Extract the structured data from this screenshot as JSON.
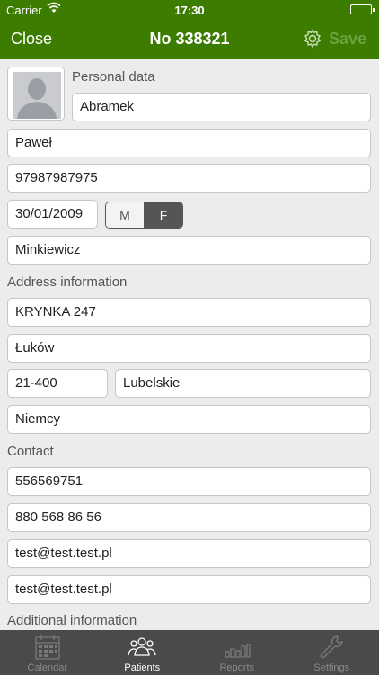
{
  "status_bar": {
    "carrier": "Carrier",
    "time": "17:30"
  },
  "nav": {
    "close": "Close",
    "title": "No 338321",
    "save": "Save"
  },
  "personal": {
    "heading": "Personal data",
    "last_name": "Abramek",
    "first_name": "Paweł",
    "pesel": "97987987975",
    "birth_date": "30/01/2009",
    "gender_options": [
      "M",
      "F"
    ],
    "gender_selected": "F",
    "other_name": "Minkiewicz"
  },
  "address": {
    "heading": "Address information",
    "street": "KRYNKA 247",
    "city": "Łuków",
    "postal_code": "21-400",
    "region": "Lubelskie",
    "country": "Niemcy"
  },
  "contact": {
    "heading": "Contact",
    "phone1": "556569751",
    "phone2": "880 568 86 56",
    "email1": "test@test.test.pl",
    "email2": "test@test.test.pl"
  },
  "additional": {
    "heading": "Additional information"
  },
  "tabs": [
    {
      "label": "Calendar",
      "icon": "calendar-icon",
      "active": false
    },
    {
      "label": "Patients",
      "icon": "patients-icon",
      "active": true
    },
    {
      "label": "Reports",
      "icon": "reports-icon",
      "active": false
    },
    {
      "label": "Settings",
      "icon": "settings-icon",
      "active": false
    }
  ],
  "colors": {
    "brand_green": "#3c7c00",
    "tabbar": "#4a4a4a",
    "save_disabled": "#6da13f"
  }
}
